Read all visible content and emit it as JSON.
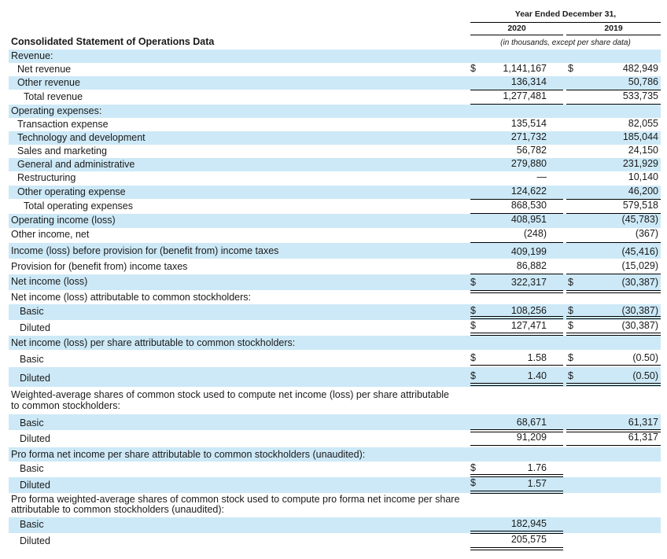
{
  "header": {
    "period_title": "Year Ended December 31,",
    "year1": "2020",
    "year2": "2019",
    "units_note": "(in thousands, except per share data)"
  },
  "section_title": "Consolidated Statement of Operations Data",
  "rows": [
    {
      "label": "Revenue:",
      "d1": "",
      "v1": "",
      "d2": "",
      "v2": ""
    },
    {
      "label": "Net revenue",
      "d1": "$",
      "v1": "1,141,167",
      "d2": "$",
      "v2": "482,949"
    },
    {
      "label": "Other revenue",
      "d1": "",
      "v1": "136,314",
      "d2": "",
      "v2": "50,786"
    },
    {
      "label": "Total revenue",
      "d1": "",
      "v1": "1,277,481",
      "d2": "",
      "v2": "533,735"
    },
    {
      "label": "Operating expenses:",
      "d1": "",
      "v1": "",
      "d2": "",
      "v2": ""
    },
    {
      "label": "Transaction expense",
      "d1": "",
      "v1": "135,514",
      "d2": "",
      "v2": "82,055"
    },
    {
      "label": "Technology and development",
      "d1": "",
      "v1": "271,732",
      "d2": "",
      "v2": "185,044"
    },
    {
      "label": "Sales and marketing",
      "d1": "",
      "v1": "56,782",
      "d2": "",
      "v2": "24,150"
    },
    {
      "label": "General and administrative",
      "d1": "",
      "v1": "279,880",
      "d2": "",
      "v2": "231,929"
    },
    {
      "label": "Restructuring",
      "d1": "",
      "v1": "—",
      "d2": "",
      "v2": "10,140"
    },
    {
      "label": "Other operating expense",
      "d1": "",
      "v1": "124,622",
      "d2": "",
      "v2": "46,200"
    },
    {
      "label": "Total operating expenses",
      "d1": "",
      "v1": "868,530",
      "d2": "",
      "v2": "579,518"
    },
    {
      "label": "Operating income (loss)",
      "d1": "",
      "v1": "408,951",
      "d2": "",
      "v2": "(45,783)"
    },
    {
      "label": "Other income, net",
      "d1": "",
      "v1": "(248)",
      "d2": "",
      "v2": "(367)"
    },
    {
      "label": "Income (loss) before provision for (benefit from) income taxes",
      "d1": "",
      "v1": "409,199",
      "d2": "",
      "v2": "(45,416)"
    },
    {
      "label": "Provision for (benefit from) income taxes",
      "d1": "",
      "v1": "86,882",
      "d2": "",
      "v2": "(15,029)"
    },
    {
      "label": "Net income (loss)",
      "d1": "$",
      "v1": "322,317",
      "d2": "$",
      "v2": "(30,387)"
    },
    {
      "label": "Net income (loss) attributable to common stockholders:",
      "d1": "",
      "v1": "",
      "d2": "",
      "v2": ""
    },
    {
      "label": "Basic",
      "d1": "$",
      "v1": "108,256",
      "d2": "$",
      "v2": "(30,387)"
    },
    {
      "label": "Diluted",
      "d1": "$",
      "v1": "127,471",
      "d2": "$",
      "v2": "(30,387)"
    },
    {
      "label": "Net income (loss) per share attributable to common stockholders:",
      "d1": "",
      "v1": "",
      "d2": "",
      "v2": ""
    },
    {
      "label": "Basic",
      "d1": "$",
      "v1": "1.58",
      "d2": "$",
      "v2": "(0.50)"
    },
    {
      "label": "Diluted",
      "d1": "$",
      "v1": "1.40",
      "d2": "$",
      "v2": "(0.50)"
    },
    {
      "label": "Weighted-average shares of common stock used to compute net income (loss) per share attributable to common stockholders:",
      "d1": "",
      "v1": "",
      "d2": "",
      "v2": ""
    },
    {
      "label": "Basic",
      "d1": "",
      "v1": "68,671",
      "d2": "",
      "v2": "61,317"
    },
    {
      "label": "Diluted",
      "d1": "",
      "v1": "91,209",
      "d2": "",
      "v2": "61,317"
    },
    {
      "label": "Pro forma net income per share attributable to common stockholders (unaudited):",
      "d1": "",
      "v1": "",
      "d2": "",
      "v2": ""
    },
    {
      "label": "Basic",
      "d1": "$",
      "v1": "1.76",
      "d2": "",
      "v2": ""
    },
    {
      "label": "Diluted",
      "d1": "$",
      "v1": "1.57",
      "d2": "",
      "v2": ""
    },
    {
      "label": "Pro forma weighted-average shares of common stock used to compute pro forma net income per share attributable to common stockholders (unaudited):",
      "d1": "",
      "v1": "",
      "d2": "",
      "v2": ""
    },
    {
      "label": "Basic",
      "d1": "",
      "v1": "182,945",
      "d2": "",
      "v2": ""
    },
    {
      "label": "Diluted",
      "d1": "",
      "v1": "205,575",
      "d2": "",
      "v2": ""
    }
  ]
}
